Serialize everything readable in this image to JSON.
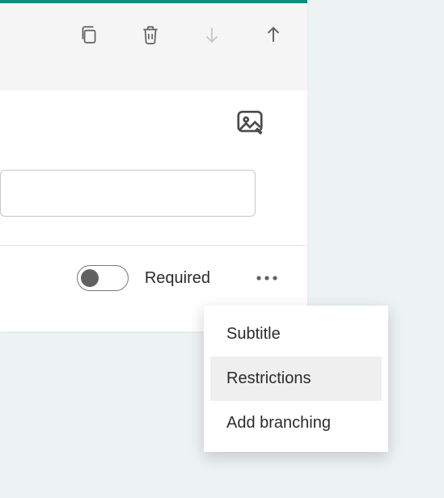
{
  "toolbar": {
    "copy": "Copy",
    "delete": "Delete",
    "move_down": "Move down",
    "move_up": "Move up"
  },
  "question": {
    "image_button": "Insert image",
    "answer_placeholder": ""
  },
  "footer": {
    "required_label": "Required",
    "more_label": "More options"
  },
  "dropdown": {
    "items": [
      {
        "label": "Subtitle"
      },
      {
        "label": "Restrictions"
      },
      {
        "label": "Add branching"
      }
    ]
  }
}
